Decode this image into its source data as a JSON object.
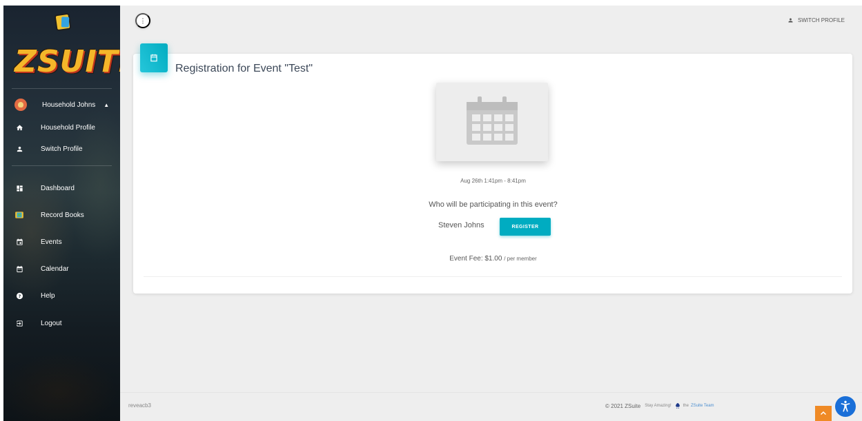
{
  "sidebar": {
    "brand": "ZSUITE",
    "user": {
      "name": "Household Johns",
      "caret_icon": "caret-up-icon"
    },
    "profile_items": [
      {
        "label": "Household Profile",
        "icon": "home-icon"
      },
      {
        "label": "Switch Profile",
        "icon": "person-icon"
      }
    ],
    "nav_items": [
      {
        "label": "Dashboard",
        "icon": "dashboard-icon"
      },
      {
        "label": "Record Books",
        "icon": "record-books-icon"
      },
      {
        "label": "Events",
        "icon": "event-icon"
      },
      {
        "label": "Calendar",
        "icon": "calendar-icon"
      },
      {
        "label": "Help",
        "icon": "help-icon"
      },
      {
        "label": "Logout",
        "icon": "logout-icon"
      }
    ]
  },
  "header": {
    "menu_icon": "more-vert-icon",
    "switch_profile_label": "SWITCH PROFILE"
  },
  "card": {
    "title": "Registration for Event \"Test\"",
    "event_date": "Aug 26th 1:41pm - 8:41pm",
    "question": "Who will be participating in this event?",
    "member_name": "Steven Johns",
    "register_label": "REGISTER",
    "fee_label": "Event Fee: $1.00",
    "fee_suffix": "/ per member"
  },
  "footer": {
    "build": "reveacb3",
    "copyright": "© 2021 ZSuite",
    "tagline": "Stay Amazing!",
    "team_prefix": "the",
    "team_link": "ZSuite Team"
  },
  "colors": {
    "accent": "#00acc1",
    "scroll_top": "#ef8a26",
    "accessibility": "#1a6fd8"
  }
}
